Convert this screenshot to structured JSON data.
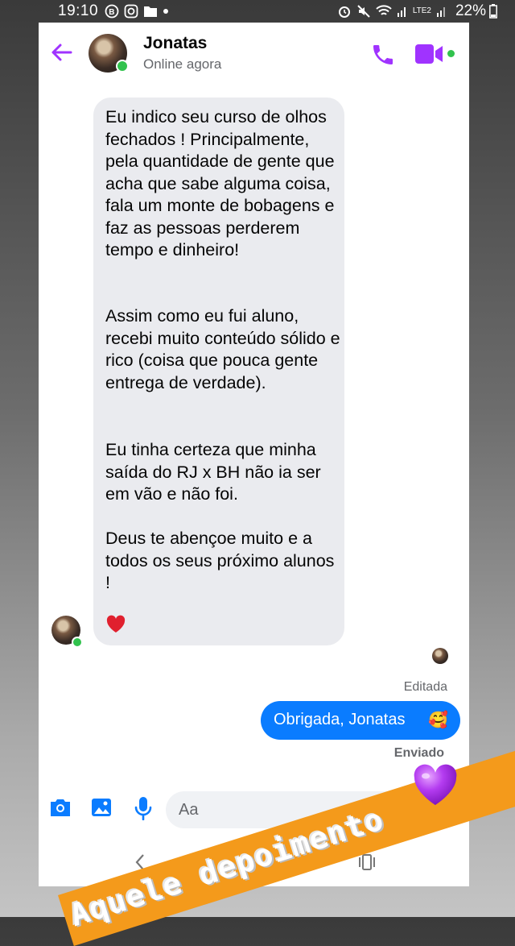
{
  "status_bar": {
    "time": "19:10",
    "battery": "22%",
    "network": "LTE2"
  },
  "header": {
    "name": "Jonatas",
    "status": "Online agora"
  },
  "messages": {
    "incoming": [
      "Eu indico seu curso de olhos fechados ! Principalmente, pela quantidade de gente que acha que sabe alguma coisa, fala um monte de bobagens e faz as pessoas perderem tempo e dinheiro!",
      "Assim como eu fui aluno, recebi muito conteúdo sólido e rico (coisa que pouca gente entrega de verdade).",
      "Eu tinha certeza que minha saída do RJ x BH não ia ser em vão e não foi.",
      "Deus te abençoe muito e a todos os seus próximo alunos !"
    ],
    "reaction": "❤️",
    "edited_label": "Editada",
    "outgoing": "Obrigada, Jonatas",
    "outgoing_emoji": "🥰",
    "sent_label": "Enviado"
  },
  "composer": {
    "placeholder": "Aa"
  },
  "sticker": {
    "text": "Aquele depoimento"
  },
  "colors": {
    "accent": "#a033ff",
    "bubble_out": "#0a7cff",
    "bubble_in": "#eaebef",
    "online": "#31c24d",
    "sticker": "#f49a1b"
  },
  "icons": [
    "back-arrow-icon",
    "phone-icon",
    "video-camera-icon",
    "camera-icon",
    "gallery-icon",
    "microphone-icon",
    "heart-icon",
    "purple-heart-icon"
  ]
}
